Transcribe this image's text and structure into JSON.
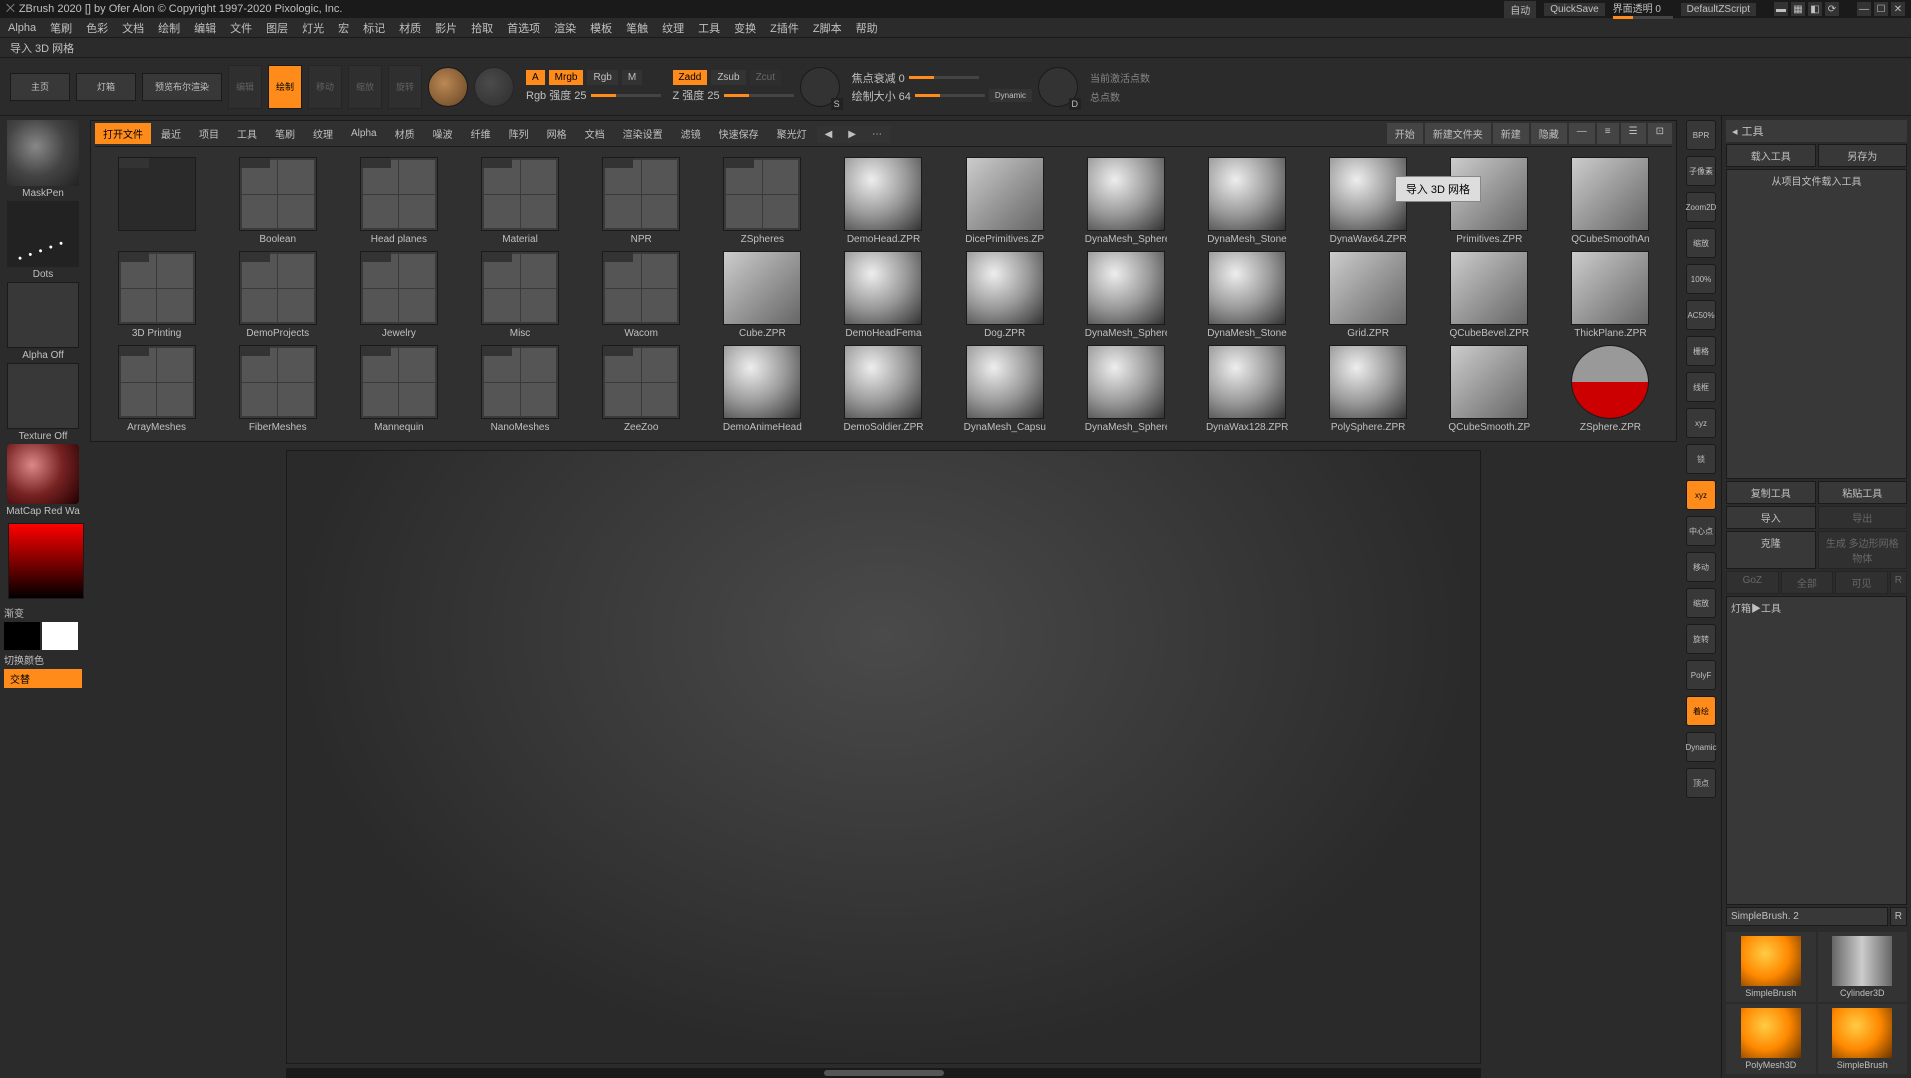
{
  "titlebar": {
    "title": "ZBrush 2020 [] by Ofer Alon © Copyright 1997-2020 Pixologic, Inc.",
    "auto": "自动",
    "quicksave": "QuickSave",
    "transparency": "界面透明 0",
    "defaultscript": "DefaultZScript"
  },
  "menu": [
    "Alpha",
    "笔刷",
    "色彩",
    "文档",
    "绘制",
    "编辑",
    "文件",
    "图层",
    "灯光",
    "宏",
    "标记",
    "材质",
    "影片",
    "拾取",
    "首选项",
    "渲染",
    "模板",
    "笔触",
    "纹理",
    "工具",
    "变换",
    "Z插件",
    "Z脚本",
    "帮助"
  ],
  "subheader": "导入 3D 网格",
  "toolbar": {
    "home": "主页",
    "lightbox": "灯箱",
    "bpr": "预览布尔渲染",
    "edit": "编辑",
    "draw": "绘制",
    "move": "移动",
    "scale": "缩放",
    "rotate": "旋转",
    "a": "A",
    "mrgb": "Mrgb",
    "rgb": "Rgb",
    "m": "M",
    "zadd": "Zadd",
    "zsub": "Zsub",
    "zcut": "Zcut",
    "rgb_intensity": "Rgb 强度 25",
    "z_intensity": "Z 强度 25",
    "focal": "焦点衰减 0",
    "drawsize": "绘制大小 64",
    "dynamic": "Dynamic",
    "activepoints": "当前激活点数",
    "totalpoints": "总点数",
    "s_icon": "S",
    "d_icon": "D"
  },
  "browser": {
    "tabs": [
      "打开文件",
      "最近",
      "项目",
      "工具",
      "笔刷",
      "纹理",
      "Alpha",
      "材质",
      "噪波",
      "纤维",
      "阵列",
      "网格",
      "文档",
      "渲染设置",
      "滤镜",
      "快速保存",
      "聚光灯"
    ],
    "right": [
      "开始",
      "新建文件夹",
      "新建",
      "隐藏"
    ],
    "row1": [
      {
        "label": "",
        "type": "folder",
        "cls": "dark"
      },
      {
        "label": "Boolean",
        "type": "folder",
        "cls": "quad"
      },
      {
        "label": "Head planes",
        "type": "folder",
        "cls": "quad"
      },
      {
        "label": "Material",
        "type": "folder",
        "cls": "quad"
      },
      {
        "label": "NPR",
        "type": "folder",
        "cls": "quad"
      },
      {
        "label": "ZSpheres",
        "type": "folder",
        "cls": "quad"
      },
      {
        "label": "DemoHead.ZPR",
        "type": "item",
        "cls": "sphere"
      },
      {
        "label": "DicePrimitives.ZP",
        "type": "item",
        "cls": "cube"
      },
      {
        "label": "DynaMesh_Sphere",
        "type": "item",
        "cls": "sphere"
      },
      {
        "label": "DynaMesh_Stone",
        "type": "item",
        "cls": "sphere"
      },
      {
        "label": "DynaWax64.ZPR",
        "type": "item",
        "cls": "sphere"
      },
      {
        "label": "Primitives.ZPR",
        "type": "item",
        "cls": "cube"
      },
      {
        "label": "QCubeSmoothAn",
        "type": "item",
        "cls": "cube"
      }
    ],
    "row2": [
      {
        "label": "3D Printing",
        "type": "folder",
        "cls": "quad"
      },
      {
        "label": "DemoProjects",
        "type": "folder",
        "cls": "quad"
      },
      {
        "label": "Jewelry",
        "type": "folder",
        "cls": "quad"
      },
      {
        "label": "Misc",
        "type": "folder",
        "cls": "quad"
      },
      {
        "label": "Wacom",
        "type": "folder",
        "cls": "quad"
      },
      {
        "label": "Cube.ZPR",
        "type": "item",
        "cls": "cube"
      },
      {
        "label": "DemoHeadFema",
        "type": "item",
        "cls": "sphere"
      },
      {
        "label": "Dog.ZPR",
        "type": "item",
        "cls": "sphere"
      },
      {
        "label": "DynaMesh_Sphere",
        "type": "item",
        "cls": "sphere"
      },
      {
        "label": "DynaMesh_Stone",
        "type": "item",
        "cls": "sphere"
      },
      {
        "label": "Grid.ZPR",
        "type": "item",
        "cls": "cube"
      },
      {
        "label": "QCubeBevel.ZPR",
        "type": "item",
        "cls": "cube"
      },
      {
        "label": "ThickPlane.ZPR",
        "type": "item",
        "cls": "cube"
      }
    ],
    "row3": [
      {
        "label": "ArrayMeshes",
        "type": "folder",
        "cls": "quad"
      },
      {
        "label": "FiberMeshes",
        "type": "folder",
        "cls": "quad"
      },
      {
        "label": "Mannequin",
        "type": "folder",
        "cls": "quad"
      },
      {
        "label": "NanoMeshes",
        "type": "folder",
        "cls": "quad"
      },
      {
        "label": "ZeeZoo",
        "type": "folder",
        "cls": "quad"
      },
      {
        "label": "DemoAnimeHead",
        "type": "item",
        "cls": "sphere"
      },
      {
        "label": "DemoSoldier.ZPR",
        "type": "item",
        "cls": "sphere"
      },
      {
        "label": "DynaMesh_Capsu",
        "type": "item",
        "cls": "sphere"
      },
      {
        "label": "DynaMesh_Sphere",
        "type": "item",
        "cls": "sphere"
      },
      {
        "label": "DynaWax128.ZPR",
        "type": "item",
        "cls": "sphere"
      },
      {
        "label": "PolySphere.ZPR",
        "type": "item",
        "cls": "sphere"
      },
      {
        "label": "QCubeSmooth.ZP",
        "type": "item",
        "cls": "cube"
      },
      {
        "label": "ZSphere.ZPR",
        "type": "item",
        "cls": "redtop"
      }
    ]
  },
  "left": {
    "brush": "MaskPen",
    "stroke": "Dots",
    "alpha": "Alpha Off",
    "texture": "Texture Off",
    "material": "MatCap Red Wa",
    "gradient": "渐变",
    "switchcolor": "切换颜色",
    "alt": "交替"
  },
  "righticons": {
    "bpr": "BPR",
    "subpix": "子像素",
    "zoom2d": "Zoom2D",
    "fit": "缩放",
    "pct": "100%",
    "ac50": "AC50%",
    "grid": "栅格",
    "wirefr": "线框",
    "xyz": "xyz",
    "lock": "锁",
    "center": "中心点",
    "move": "移动",
    "zoom": "缩放",
    "rotate": "旋转",
    "polyf": "PolyF",
    "hist": "着绘",
    "dyn": "Dynamic",
    "persp": "顶点"
  },
  "rightpanel": {
    "title": "工具",
    "load": "载入工具",
    "saveas": "另存为",
    "loadproj": "从项目文件载入工具",
    "copy": "复制工具",
    "paste": "粘贴工具",
    "import": "导入",
    "export": "导出",
    "clone": "克隆",
    "gen": "生成 多边形网格物体",
    "goz": "GoZ",
    "all": "全部",
    "visible": "可见",
    "r": "R",
    "lightbox": "灯箱▶工具",
    "current": "SimpleBrush. 2",
    "tools": [
      {
        "name": "SimpleBrush",
        "cls": "s"
      },
      {
        "name": "Cylinder3D",
        "cls": "cyl"
      },
      {
        "name": "",
        "cls": "s",
        "sub": "PolyMesh3D"
      },
      {
        "name": "SimpleBrush",
        "cls": "s"
      }
    ]
  },
  "tooltip": "导入 3D 网格"
}
